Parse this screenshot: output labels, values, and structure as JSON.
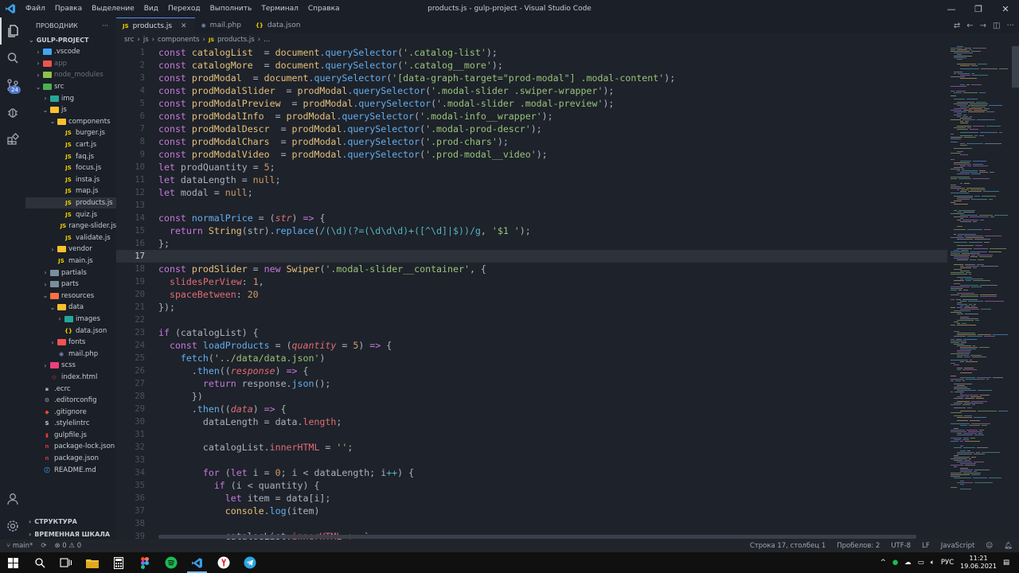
{
  "titlebar": {
    "menu": [
      "Файл",
      "Правка",
      "Выделение",
      "Вид",
      "Переход",
      "Выполнить",
      "Терминал",
      "Справка"
    ],
    "title": "products.js - gulp-project - Visual Studio Code"
  },
  "activity_bar": {
    "badge": "24"
  },
  "explorer": {
    "header": "ПРОВОДНИК",
    "more": "···",
    "project": "GULP-PROJECT",
    "items": [
      {
        "label": ".vscode",
        "type": "folder",
        "depth": 1,
        "chev": "›",
        "color": "#42a5f5"
      },
      {
        "label": "app",
        "type": "folder",
        "depth": 1,
        "chev": "›",
        "color": "#ef5350",
        "dim": true
      },
      {
        "label": "node_modules",
        "type": "folder",
        "depth": 1,
        "chev": "›",
        "color": "#8bc34a",
        "dim": true
      },
      {
        "label": "src",
        "type": "folder",
        "depth": 1,
        "chev": "⌄",
        "color": "#4caf50"
      },
      {
        "label": "img",
        "type": "folder",
        "depth": 2,
        "chev": "›",
        "color": "#26a69a"
      },
      {
        "label": "js",
        "type": "folder",
        "depth": 2,
        "chev": "⌄",
        "color": "#fbc02d"
      },
      {
        "label": "components",
        "type": "folder",
        "depth": 3,
        "chev": "⌄",
        "color": "#fbc02d"
      },
      {
        "label": "burger.js",
        "type": "js",
        "depth": 4
      },
      {
        "label": "cart.js",
        "type": "js",
        "depth": 4
      },
      {
        "label": "faq.js",
        "type": "js",
        "depth": 4
      },
      {
        "label": "focus.js",
        "type": "js",
        "depth": 4
      },
      {
        "label": "insta.js",
        "type": "js",
        "depth": 4
      },
      {
        "label": "map.js",
        "type": "js",
        "depth": 4
      },
      {
        "label": "products.js",
        "type": "js",
        "depth": 4,
        "selected": true
      },
      {
        "label": "quiz.js",
        "type": "js",
        "depth": 4
      },
      {
        "label": "range-slider.js",
        "type": "js",
        "depth": 4
      },
      {
        "label": "validate.js",
        "type": "js",
        "depth": 4
      },
      {
        "label": "vendor",
        "type": "folder",
        "depth": 3,
        "chev": "›",
        "color": "#fbc02d"
      },
      {
        "label": "main.js",
        "type": "js",
        "depth": 3
      },
      {
        "label": "partials",
        "type": "folder",
        "depth": 2,
        "chev": "›",
        "color": "#78909c"
      },
      {
        "label": "parts",
        "type": "folder",
        "depth": 2,
        "chev": "›",
        "color": "#78909c"
      },
      {
        "label": "resources",
        "type": "folder",
        "depth": 2,
        "chev": "⌄",
        "color": "#ff7043"
      },
      {
        "label": "data",
        "type": "folder",
        "depth": 3,
        "chev": "⌄",
        "color": "#fbc02d"
      },
      {
        "label": "images",
        "type": "folder",
        "depth": 4,
        "chev": "›",
        "color": "#26a69a"
      },
      {
        "label": "data.json",
        "type": "json",
        "depth": 4
      },
      {
        "label": "fonts",
        "type": "folder",
        "depth": 3,
        "chev": "›",
        "color": "#ef5350"
      },
      {
        "label": "mail.php",
        "type": "php",
        "depth": 3
      },
      {
        "label": "scss",
        "type": "folder",
        "depth": 2,
        "chev": "›",
        "color": "#ec407a"
      },
      {
        "label": "index.html",
        "type": "html",
        "depth": 2
      },
      {
        "label": ".ecrc",
        "type": "cfg",
        "depth": 1
      },
      {
        "label": ".editorconfig",
        "type": "cfg2",
        "depth": 1
      },
      {
        "label": ".gitignore",
        "type": "git",
        "depth": 1
      },
      {
        "label": ".stylelintrc",
        "type": "cfg3",
        "depth": 1
      },
      {
        "label": "gulpfile.js",
        "type": "gulp",
        "depth": 1
      },
      {
        "label": "package-lock.json",
        "type": "npm",
        "depth": 1
      },
      {
        "label": "package.json",
        "type": "npm",
        "depth": 1
      },
      {
        "label": "README.md",
        "type": "md",
        "depth": 1
      }
    ],
    "outline_label": "СТРУКТУРА",
    "timeline_label": "ВРЕМЕННАЯ ШКАЛА"
  },
  "tabs": [
    {
      "label": "products.js",
      "type": "js",
      "active": true
    },
    {
      "label": "mail.php",
      "type": "php",
      "active": false
    },
    {
      "label": "data.json",
      "type": "json",
      "active": false
    }
  ],
  "breadcrumb": [
    "src",
    "js",
    "components",
    "products.js",
    "..."
  ],
  "editor": {
    "current_line": 17,
    "lines": [
      [
        [
          "kw",
          "const "
        ],
        [
          "var",
          "catalogList"
        ],
        [
          "",
          "  = "
        ],
        [
          "var",
          "document"
        ],
        [
          "",
          ""
        ],
        [
          "fn",
          ".querySelector"
        ],
        [
          "",
          "("
        ],
        [
          "str",
          "'.catalog-list'"
        ],
        [
          "",
          ");"
        ]
      ],
      [
        [
          "kw",
          "const "
        ],
        [
          "var",
          "catalogMore"
        ],
        [
          "",
          "  = "
        ],
        [
          "var",
          "document"
        ],
        [
          "fn",
          ".querySelector"
        ],
        [
          "",
          "("
        ],
        [
          "str",
          "'.catalog__more'"
        ],
        [
          "",
          ");"
        ]
      ],
      [
        [
          "kw",
          "const "
        ],
        [
          "var",
          "prodModal"
        ],
        [
          "",
          "  = "
        ],
        [
          "var",
          "document"
        ],
        [
          "fn",
          ".querySelector"
        ],
        [
          "",
          "("
        ],
        [
          "str",
          "'[data-graph-target=\"prod-modal\"] .modal-content'"
        ],
        [
          "",
          ");"
        ]
      ],
      [
        [
          "kw",
          "const "
        ],
        [
          "var",
          "prodModalSlider"
        ],
        [
          "",
          "  = "
        ],
        [
          "var",
          "prodModal"
        ],
        [
          "fn",
          ".querySelector"
        ],
        [
          "",
          "("
        ],
        [
          "str",
          "'.modal-slider .swiper-wrapper'"
        ],
        [
          "",
          ");"
        ]
      ],
      [
        [
          "kw",
          "const "
        ],
        [
          "var",
          "prodModalPreview"
        ],
        [
          "",
          "  = "
        ],
        [
          "var",
          "prodModal"
        ],
        [
          "fn",
          ".querySelector"
        ],
        [
          "",
          "("
        ],
        [
          "str",
          "'.modal-slider .modal-preview'"
        ],
        [
          "",
          ");"
        ]
      ],
      [
        [
          "kw",
          "const "
        ],
        [
          "var",
          "prodModalInfo"
        ],
        [
          "",
          "  = "
        ],
        [
          "var",
          "prodModal"
        ],
        [
          "fn",
          ".querySelector"
        ],
        [
          "",
          "("
        ],
        [
          "str",
          "'.modal-info__wrapper'"
        ],
        [
          "",
          ");"
        ]
      ],
      [
        [
          "kw",
          "const "
        ],
        [
          "var",
          "prodModalDescr"
        ],
        [
          "",
          "  = "
        ],
        [
          "var",
          "prodModal"
        ],
        [
          "fn",
          ".querySelector"
        ],
        [
          "",
          "("
        ],
        [
          "str",
          "'.modal-prod-descr'"
        ],
        [
          "",
          ");"
        ]
      ],
      [
        [
          "kw",
          "const "
        ],
        [
          "var",
          "prodModalChars"
        ],
        [
          "",
          "  = "
        ],
        [
          "var",
          "prodModal"
        ],
        [
          "fn",
          ".querySelector"
        ],
        [
          "",
          "("
        ],
        [
          "str",
          "'.prod-chars'"
        ],
        [
          "",
          ");"
        ]
      ],
      [
        [
          "kw",
          "const "
        ],
        [
          "var",
          "prodModalVideo"
        ],
        [
          "",
          "  = "
        ],
        [
          "var",
          "prodModal"
        ],
        [
          "fn",
          ".querySelector"
        ],
        [
          "",
          "("
        ],
        [
          "str",
          "'.prod-modal__video'"
        ],
        [
          "",
          ");"
        ]
      ],
      [
        [
          "kw",
          "let "
        ],
        [
          "",
          "prodQuantity = "
        ],
        [
          "num",
          "5"
        ],
        [
          "",
          ";"
        ]
      ],
      [
        [
          "kw",
          "let "
        ],
        [
          "",
          "dataLength = "
        ],
        [
          "num",
          "null"
        ],
        [
          "",
          ";"
        ]
      ],
      [
        [
          "kw",
          "let "
        ],
        [
          "",
          "modal = "
        ],
        [
          "num",
          "null"
        ],
        [
          "",
          ";"
        ]
      ],
      [],
      [
        [
          "kw",
          "const "
        ],
        [
          "fn",
          "normalPrice"
        ],
        [
          "",
          " = ("
        ],
        [
          "prm",
          "str"
        ],
        [
          "",
          ") "
        ],
        [
          "kw",
          "=>"
        ],
        [
          "",
          " {"
        ]
      ],
      [
        [
          "",
          "  "
        ],
        [
          "kw",
          "return "
        ],
        [
          "cls",
          "String"
        ],
        [
          "",
          "(str)."
        ],
        [
          "fn",
          "replace"
        ],
        [
          "",
          "("
        ],
        [
          "rx",
          "/(\\d)(?=(\\d\\d\\d)+([^\\d]|$))/g"
        ],
        [
          "",
          ", "
        ],
        [
          "str",
          "'$1 '"
        ],
        [
          "",
          ");"
        ]
      ],
      [
        [
          "",
          "};"
        ]
      ],
      [],
      [
        [
          "kw",
          "const "
        ],
        [
          "var",
          "prodSlider"
        ],
        [
          "",
          " = "
        ],
        [
          "kw",
          "new "
        ],
        [
          "cls",
          "Swiper"
        ],
        [
          "",
          "("
        ],
        [
          "str",
          "'.modal-slider__container'"
        ],
        [
          "",
          ", {"
        ]
      ],
      [
        [
          "",
          "  "
        ],
        [
          "prop",
          "slidesPerView"
        ],
        [
          "",
          ": "
        ],
        [
          "num",
          "1"
        ],
        [
          "",
          ","
        ]
      ],
      [
        [
          "",
          "  "
        ],
        [
          "prop",
          "spaceBetween"
        ],
        [
          "",
          ": "
        ],
        [
          "num",
          "20"
        ]
      ],
      [
        [
          "",
          "});"
        ]
      ],
      [],
      [
        [
          "kw",
          "if "
        ],
        [
          "",
          "(catalogList) {"
        ]
      ],
      [
        [
          "",
          "  "
        ],
        [
          "kw",
          "const "
        ],
        [
          "fn",
          "loadProducts"
        ],
        [
          "",
          " = ("
        ],
        [
          "prm",
          "quantity"
        ],
        [
          "",
          " = "
        ],
        [
          "num",
          "5"
        ],
        [
          "",
          ") "
        ],
        [
          "kw",
          "=>"
        ],
        [
          "",
          " {"
        ]
      ],
      [
        [
          "",
          "    "
        ],
        [
          "fn",
          "fetch"
        ],
        [
          "",
          "("
        ],
        [
          "str",
          "'../data/data.json'"
        ],
        [
          "",
          ")"
        ]
      ],
      [
        [
          "",
          "      ."
        ],
        [
          "fn",
          "then"
        ],
        [
          "",
          "(("
        ],
        [
          "prm",
          "response"
        ],
        [
          "",
          ") "
        ],
        [
          "kw",
          "=>"
        ],
        [
          "",
          " {"
        ]
      ],
      [
        [
          "",
          "        "
        ],
        [
          "kw",
          "return "
        ],
        [
          "",
          "response."
        ],
        [
          "fn",
          "json"
        ],
        [
          "",
          "();"
        ]
      ],
      [
        [
          "",
          "      })"
        ]
      ],
      [
        [
          "",
          "      ."
        ],
        [
          "fn",
          "then"
        ],
        [
          "",
          "(("
        ],
        [
          "prm",
          "data"
        ],
        [
          "",
          ") "
        ],
        [
          "kw",
          "=>"
        ],
        [
          "",
          " {"
        ]
      ],
      [
        [
          "",
          "        dataLength = data."
        ],
        [
          "prop",
          "length"
        ],
        [
          "",
          ";"
        ]
      ],
      [],
      [
        [
          "",
          "        catalogList."
        ],
        [
          "prop",
          "innerHTML"
        ],
        [
          "",
          " = "
        ],
        [
          "str",
          "''"
        ],
        [
          "",
          ";"
        ]
      ],
      [],
      [
        [
          "",
          "        "
        ],
        [
          "kw",
          "for "
        ],
        [
          "",
          "("
        ],
        [
          "kw",
          "let "
        ],
        [
          "",
          "i = "
        ],
        [
          "num",
          "0"
        ],
        [
          "",
          "; i < dataLength; i"
        ],
        [
          "op",
          "++"
        ],
        [
          "",
          ") {"
        ]
      ],
      [
        [
          "",
          "          "
        ],
        [
          "kw",
          "if "
        ],
        [
          "",
          "(i < quantity) {"
        ]
      ],
      [
        [
          "",
          "            "
        ],
        [
          "kw",
          "let "
        ],
        [
          "",
          "item = data[i];"
        ]
      ],
      [
        [
          "",
          "            "
        ],
        [
          "var",
          "console"
        ],
        [
          "",
          "."
        ],
        [
          "fn",
          "log"
        ],
        [
          "",
          "(item)"
        ]
      ],
      [],
      [
        [
          "",
          "            catalogList."
        ],
        [
          "prop",
          "innerHTML"
        ],
        [
          "",
          " += "
        ],
        [
          "str",
          "`"
        ]
      ]
    ]
  },
  "statusbar": {
    "branch": "main*",
    "sync_icon": "⟳",
    "problems": "⊗ 0 ⚠ 0",
    "position": "Строка 17, столбец 1",
    "spaces": "Пробелов: 2",
    "encoding": "UTF-8",
    "eol": "LF",
    "language": "JavaScript"
  },
  "taskbar": {
    "lang": "РУС",
    "time": "11:21",
    "date": "19.06.2021"
  },
  "colors": {
    "editor_bg": "#1e222a",
    "sidebar_bg": "#1b1f27",
    "accent": "#528bff"
  }
}
